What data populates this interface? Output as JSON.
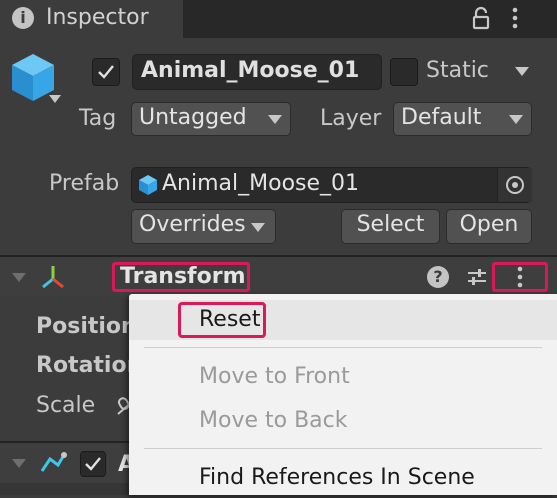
{
  "tab": {
    "title": "Inspector"
  },
  "header": {
    "name": "Animal_Moose_01",
    "active": true,
    "static_label": "Static",
    "tag_label": "Tag",
    "tag_value": "Untagged",
    "layer_label": "Layer",
    "layer_value": "Default"
  },
  "prefab": {
    "label": "Prefab",
    "value": "Animal_Moose_01",
    "overrides_label": "Overrides",
    "select_label": "Select",
    "open_label": "Open"
  },
  "transform": {
    "title": "Transform",
    "properties": [
      "Position",
      "Rotation",
      "Scale"
    ]
  },
  "next_component": {
    "title": "A",
    "enabled": true
  },
  "context_menu": {
    "items": [
      {
        "label": "Reset",
        "enabled": true
      },
      {
        "label": "Move to Front",
        "enabled": false
      },
      {
        "label": "Move to Back",
        "enabled": false
      },
      {
        "label": "Find References In Scene",
        "enabled": true
      }
    ]
  },
  "colors": {
    "highlight": "#d8195a",
    "panel": "#3c3c3c",
    "menu": "#f2f2f2",
    "cube": "#37a6e6"
  }
}
